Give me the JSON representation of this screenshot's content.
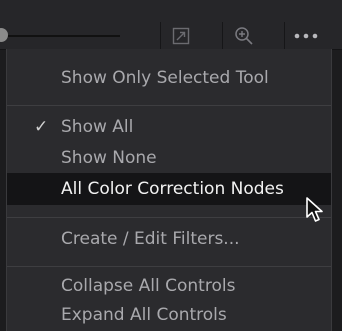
{
  "toolbar": {
    "buttons": [
      {
        "name": "expand-icon"
      },
      {
        "name": "zoom-icon"
      },
      {
        "name": "more-options-icon"
      }
    ]
  },
  "menu": {
    "items": [
      {
        "label": "Show Only Selected Tool",
        "checked": false,
        "highlighted": false
      },
      {
        "label": "Show All",
        "checked": true,
        "highlighted": false
      },
      {
        "label": "Show None",
        "checked": false,
        "highlighted": false
      },
      {
        "label": "All Color Correction Nodes",
        "checked": false,
        "highlighted": true
      },
      {
        "label": "Create / Edit Filters...",
        "checked": false,
        "highlighted": false
      },
      {
        "label": "Collapse All Controls",
        "checked": false,
        "highlighted": false
      },
      {
        "label": "Expand All Controls",
        "checked": false,
        "highlighted": false
      }
    ],
    "check_glyph": "✓"
  },
  "colors": {
    "menu_bg": "#2b2b2e",
    "highlight_bg": "#141416",
    "text": "#a9a9ad",
    "highlight_text": "#f2f2f2"
  }
}
